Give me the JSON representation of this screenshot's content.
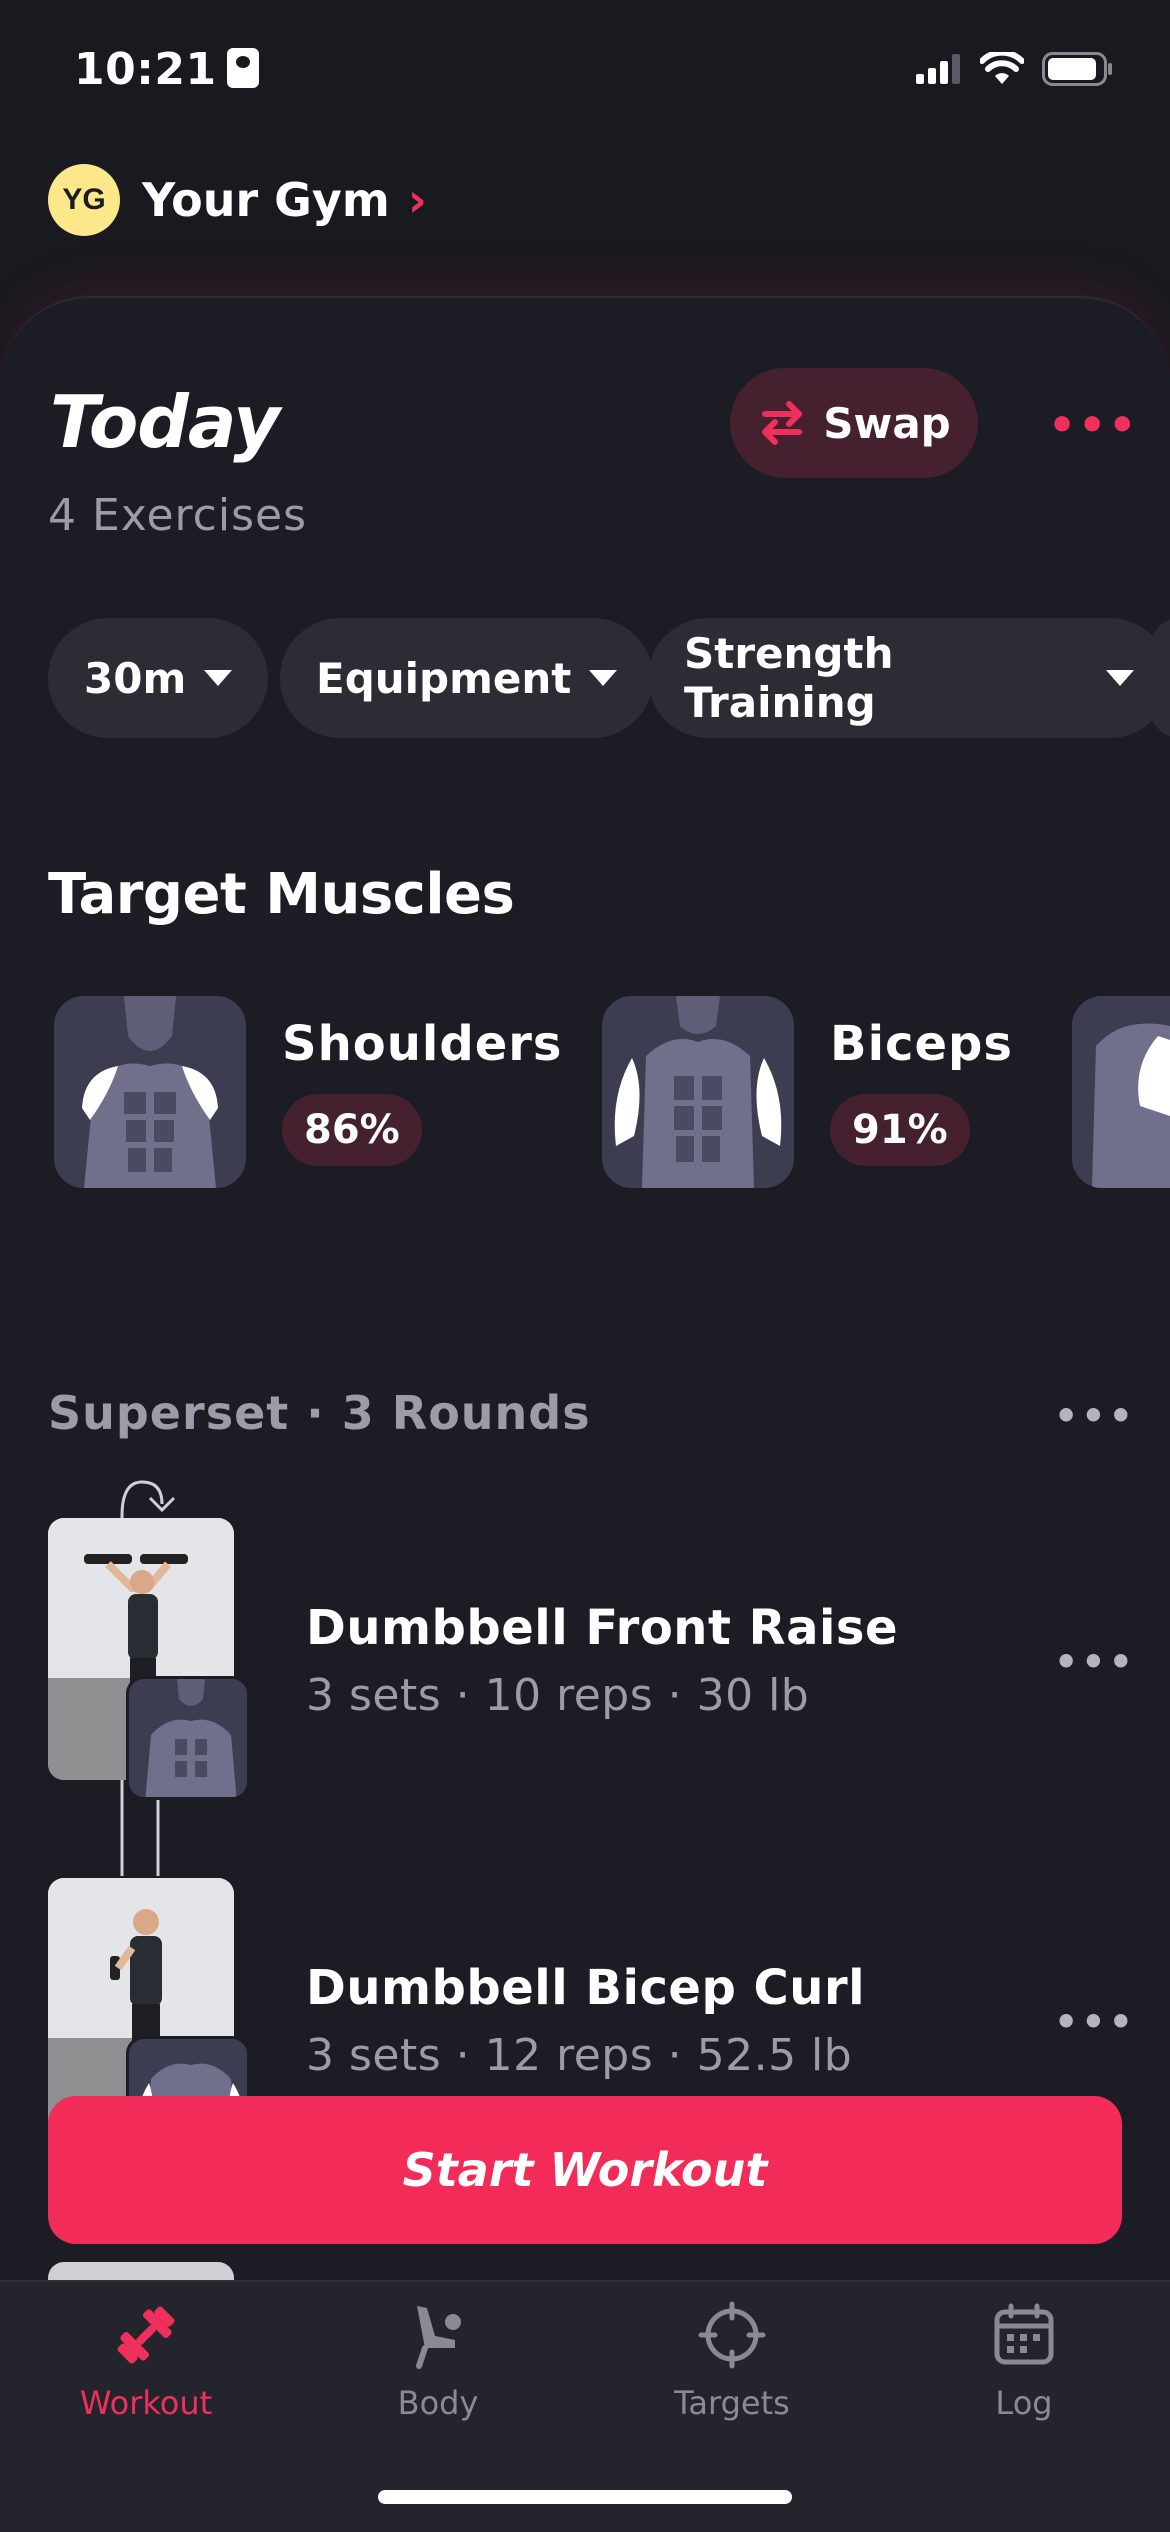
{
  "status_bar": {
    "time": "10:21"
  },
  "gym": {
    "initials": "YG",
    "name": "Your Gym"
  },
  "today": {
    "title": "Today",
    "subtitle": "4 Exercises",
    "swap_label": "Swap"
  },
  "filters": [
    {
      "label": "30m"
    },
    {
      "label": "Equipment"
    },
    {
      "label": "Strength Training"
    }
  ],
  "target_muscles": {
    "title": "Target Muscles",
    "items": [
      {
        "name": "Shoulders",
        "percent": "86%"
      },
      {
        "name": "Biceps",
        "percent": "91%"
      }
    ]
  },
  "superset": {
    "title": "Superset · 3 Rounds",
    "exercises": [
      {
        "name": "Dumbbell Front Raise",
        "meta": "3 sets · 10 reps · 30 lb"
      },
      {
        "name": "Dumbbell Bicep Curl",
        "meta": "3 sets · 12 reps · 52.5 lb"
      }
    ]
  },
  "start_button": "Start Workout",
  "tabs": [
    {
      "label": "Workout",
      "icon": "dumbbell-icon",
      "active": true
    },
    {
      "label": "Body",
      "icon": "body-icon",
      "active": false
    },
    {
      "label": "Targets",
      "icon": "target-icon",
      "active": false
    },
    {
      "label": "Log",
      "icon": "calendar-icon",
      "active": false
    }
  ],
  "colors": {
    "accent": "#f22b58",
    "background": "#191920",
    "chip": "#2c2c34",
    "badge": "#45202e"
  }
}
